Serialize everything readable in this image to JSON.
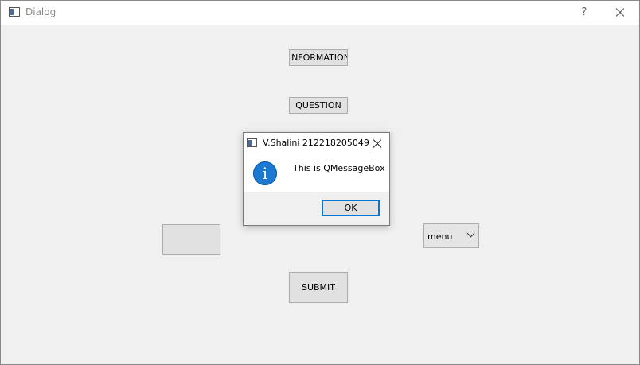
{
  "window": {
    "title": "Dialog",
    "help_glyph": "?"
  },
  "buttons": {
    "information": "NFORMATION",
    "question": "QUESTION",
    "submit": "SUBMIT",
    "blank": ""
  },
  "combo": {
    "selected": "menu"
  },
  "message_box": {
    "title": "V.Shalini 212218205049",
    "text": "This is QMessageBox",
    "icon": "information-icon",
    "icon_glyph": "i",
    "ok_label": "OK",
    "accent": "#0078d7"
  }
}
